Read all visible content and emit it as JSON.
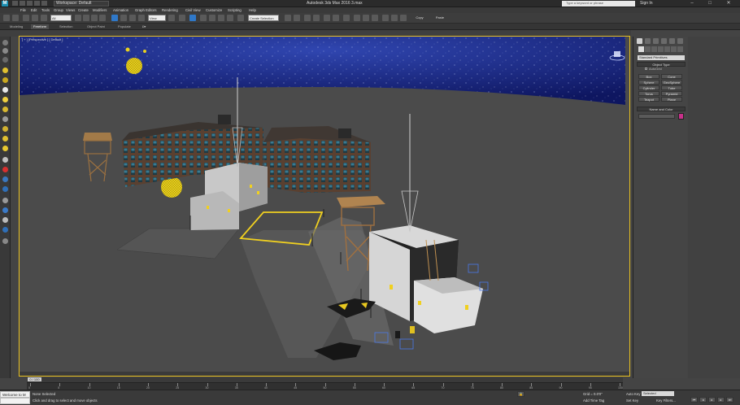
{
  "titlebar": {
    "workspace": "Workspace: Default",
    "title": "Autodesk 3ds Max 2016    3.max",
    "search_placeholder": "Type a keyword or phrase",
    "signin": "Sign In"
  },
  "menu": [
    "File",
    "Edit",
    "Tools",
    "Group",
    "Views",
    "Create",
    "Modifiers",
    "Animation",
    "Graph Editors",
    "Rendering",
    "Civil View",
    "Customize",
    "Scripting",
    "Help"
  ],
  "toolbar": {
    "filter": "All",
    "view": "View",
    "selection_set": "Create Selection Set",
    "copy": "Copy",
    "paste": "Paste"
  },
  "ribbon_tabs": [
    "Modeling",
    "Freeform",
    "Selection",
    "Object Paint",
    "Populate"
  ],
  "viewport": {
    "label": "[ + ] [Perspective ] [ Default ]"
  },
  "command_panel": {
    "category": "Standard Primitives",
    "object_type_title": "Object Type",
    "autogrid": "AutoGrid",
    "primitives": [
      "Box",
      "Cone",
      "Sphere",
      "GeoSphere",
      "Cylinder",
      "Tube",
      "Torus",
      "Pyramid",
      "Teapot",
      "Plane"
    ],
    "name_color_title": "Name and Color",
    "color": "#c8308a"
  },
  "timeline": {
    "slider": "0 / 100",
    "ticks": [
      "0",
      "5",
      "10",
      "15",
      "20",
      "25",
      "30",
      "35",
      "40",
      "45",
      "50",
      "55",
      "60",
      "65",
      "70",
      "75",
      "80",
      "85",
      "90",
      "95",
      "100"
    ]
  },
  "status": {
    "maxscript": "Welcome to M",
    "selection": "None Selected",
    "prompt": "Click and drag to select and move objects",
    "grid": "Grid = 0.0'0\"",
    "time_tag": "Add Time Tag",
    "auto_key": "Auto Key",
    "set_key": "Set Key",
    "key_mode": "Selected",
    "key_filters": "Key Filters..."
  }
}
